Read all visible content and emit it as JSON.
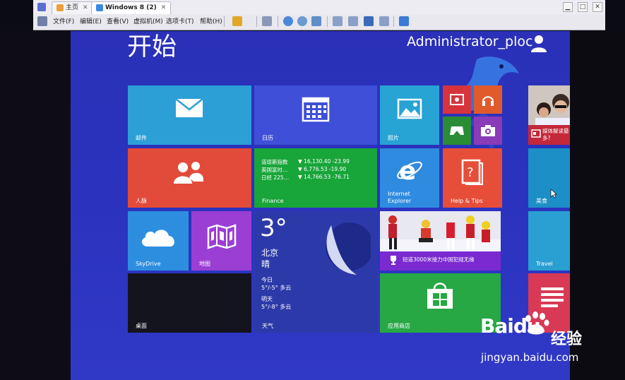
{
  "vm_window": {
    "tabs": [
      {
        "label": "主页",
        "active": false
      },
      {
        "label": "Windows 8 (2)",
        "active": true
      }
    ],
    "menu": [
      "文件(F)",
      "编辑(E)",
      "查看(V)",
      "虚拟机(M)",
      "选项卡(T)",
      "帮助(H)"
    ]
  },
  "start": {
    "title": "开始",
    "user_name": "Administrator_ploc"
  },
  "tiles": {
    "mail": "邮件",
    "calendar": "日历",
    "photos": "照片",
    "people": "人脉",
    "finance": {
      "label": "Finance",
      "rows": [
        {
          "name": "道琼斯指数",
          "value": "▼ 16,130.40 -23.99"
        },
        {
          "name": "英国富时…",
          "value": "▼ 6,776.53 -19.90"
        },
        {
          "name": "日经 225…",
          "value": "▼ 14,766.53 -76.71"
        }
      ]
    },
    "ie": "Internet Explorer",
    "help": "Help & Tips",
    "skydrive": "SkyDrive",
    "maps": "地图",
    "weather": {
      "label": "天气",
      "temp": "3°",
      "city": "北京",
      "condition": "晴",
      "today_label": "今日",
      "today": "5°/-5° 多云",
      "tomorrow_label": "明天",
      "tomorrow": "5°/-8° 多云"
    },
    "sports_news": "短道3000米接力中国犯规无缘",
    "desktop": "桌面",
    "store": "应用商店",
    "news_right": "媒体解读最多?",
    "food": "美食",
    "travel": "Travel"
  },
  "watermark": {
    "brand": "Baidu",
    "brand_cn": "经验",
    "url": "jingyan.baidu.com"
  },
  "colors": {
    "background": "#2b33bf",
    "mail": "#2c9fd6",
    "calendar": "#3f4fd8",
    "photos": "#27a3d4",
    "video": "#d6343c",
    "music": "#e05a2c",
    "games": "#2a8c34",
    "camera": "#8a3bb8",
    "people": "#e24a3a",
    "finance": "#18a53a",
    "ie": "#2f8be0",
    "help": "#e64e3a",
    "skydrive": "#2d8ee0",
    "maps": "#9b3ed4",
    "weather": "#2c3aa9",
    "desktop": "#14141e",
    "store": "#27a844",
    "travel": "#2a9fd2",
    "food": "#1c8fc7",
    "reading": "#d83a55"
  }
}
